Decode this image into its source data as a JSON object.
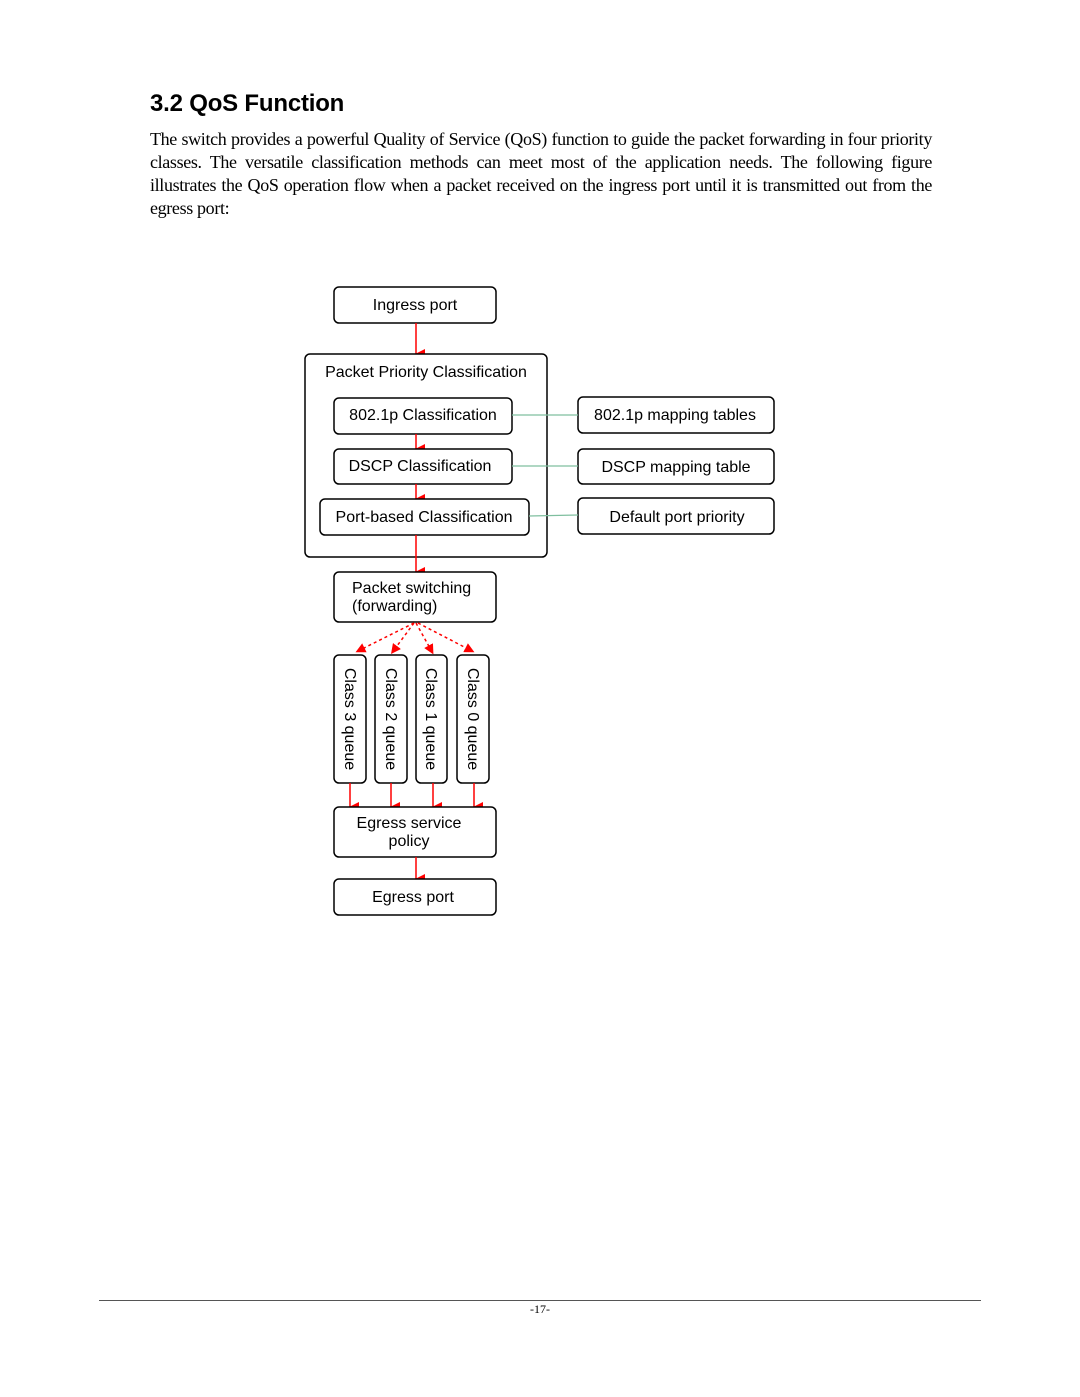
{
  "section": {
    "title": "3.2 QoS Function",
    "paragraph": "The switch provides a powerful Quality of Service (QoS) function to guide the packet forwarding in four priority classes. The versatile classification methods can meet most of the application needs. The following figure illustrates the QoS operation flow when a packet received on the ingress port until it is transmitted out from the egress port:"
  },
  "diagram": {
    "ingress_port": "Ingress port",
    "classification_group": "Packet Priority Classification",
    "classifiers": [
      "802.1p Classification",
      "DSCP Classification",
      "Port-based Classification"
    ],
    "mapping_sources": [
      "802.1p mapping tables",
      "DSCP mapping table",
      "Default port priority"
    ],
    "packet_switching": [
      "Packet switching",
      "(forwarding)"
    ],
    "queues": [
      "Class 3 queue",
      "Class 2 queue",
      "Class 1 queue",
      "Class 0 queue"
    ],
    "egress_policy": [
      "Egress service",
      "policy"
    ],
    "egress_port": "Egress port",
    "colors": {
      "flow_arrow": "#ff0000",
      "mapping_link": "#7fbf9f",
      "box_stroke": "#000000"
    }
  },
  "footer": {
    "page_number": "-17-"
  }
}
